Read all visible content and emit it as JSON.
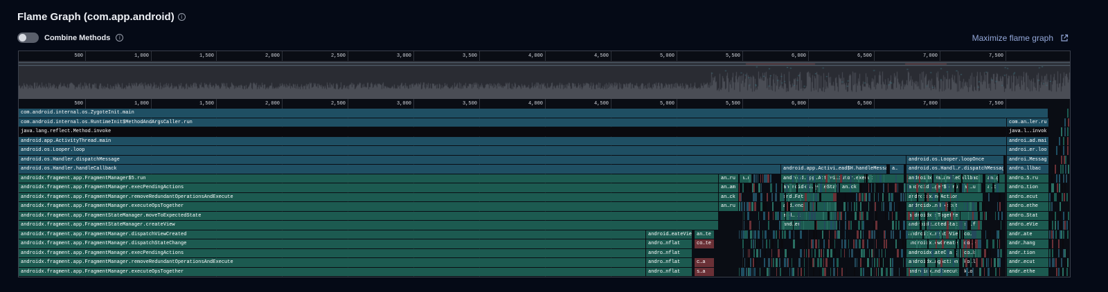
{
  "header": {
    "title": "Flame Graph (com.app.android)",
    "info_icon": "info-icon"
  },
  "controls": {
    "toggle_label": "Combine Methods",
    "toggle_on": false,
    "maximize_label": "Maximize flame graph",
    "maximize_icon": "external-link-icon"
  },
  "axis": {
    "ticks": [
      "500",
      "1,000",
      "1,500",
      "2,000",
      "2,500",
      "3,000",
      "3,500",
      "4,000",
      "4,500",
      "5,000",
      "5,500",
      "6,000",
      "6,500",
      "7,000",
      "7,500"
    ]
  },
  "colors": {
    "blue_frame": "#1f4f63",
    "teal_frame": "#1c5a50",
    "black_frame": "#0a0a0e",
    "red_frame": "#6a3036"
  },
  "stack_rows": [
    {
      "main": "com.android.internal.os.ZygoteInit.main",
      "color": "blue",
      "right": ""
    },
    {
      "main": "com.android.internal.os.RuntimeInit$MethodAndArgsCaller.run",
      "color": "blue",
      "right": "com.an…ler.ru"
    },
    {
      "main": "java.lang.reflect.Method.invoke",
      "color": "black",
      "right": "java.l….invok"
    },
    {
      "main": "android.app.ActivityThread.main",
      "color": "blue",
      "right": "androi…ad.mai"
    },
    {
      "main": "android.os.Looper.loop",
      "color": "blue",
      "right": "androi…er.loo"
    },
    {
      "main": "android.os.Handler.dispatchMessage",
      "color": "blue",
      "right": "androi…Messag"
    },
    {
      "main": "android.os.Handler.handleCallback",
      "color": "blue",
      "right": "andro…llbac"
    },
    {
      "main": "androidx.fragment.app.FragmentManager$5.run",
      "color": "teal",
      "right": "andro…5.ru"
    },
    {
      "main": "androidx.fragment.app.FragmentManager.execPendingActions",
      "color": "teal",
      "right": "andro…tion"
    },
    {
      "main": "androidx.fragment.app.FragmentManager.removeRedundantOperationsAndExecute",
      "color": "teal",
      "right": "andro…ecut"
    },
    {
      "main": "androidx.fragment.app.FragmentManager.executeOpsTogether",
      "color": "teal",
      "right": "andro…ethe"
    },
    {
      "main": "androidx.fragment.app.FragmentStateManager.moveToExpectedState",
      "color": "teal",
      "right": "andro…Stat"
    },
    {
      "main": "androidx.fragment.app.FragmentStateManager.createView",
      "color": "teal",
      "right": "andro…eVie"
    },
    {
      "main": "androidx.fragment.app.FragmentManager.dispatchViewCreated",
      "color": "teal",
      "right": "andr…ate"
    },
    {
      "main": "androidx.fragment.app.FragmentManager.dispatchStateChange",
      "color": "teal",
      "right": "andr…hang"
    },
    {
      "main": "androidx.fragment.app.FragmentManager.execPendingActions",
      "color": "teal",
      "right": "andr…tion"
    },
    {
      "main": "androidx.fragment.app.FragmentManager.removeRedundantOperationsAndExecute",
      "color": "teal",
      "right": "andr…ecut"
    },
    {
      "main": "androidx.fragment.app.FragmentManager.executeOpsTogether",
      "color": "teal",
      "right": "andr…ethe"
    }
  ],
  "sub_frames": [
    {
      "row": 5,
      "label": "android.os.Looper.loopOnce",
      "color": "blue"
    },
    {
      "row": 6,
      "label": "android.app.Activi…ead$H.handleMessag",
      "color": "blue"
    },
    {
      "row": 6,
      "label": "a…",
      "color": "blue"
    },
    {
      "row": 6,
      "label": "android.os.Handl…r.dispatchMessag",
      "color": "blue"
    },
    {
      "row": 7,
      "label": "an…ru",
      "color": "teal"
    },
    {
      "row": 7,
      "label": "a…u",
      "color": "teal"
    },
    {
      "row": 7,
      "label": "android.app.Activi…cutor.execut",
      "color": "teal"
    },
    {
      "row": 7,
      "label": "androidx.Ha…andleCallbac",
      "color": "teal"
    },
    {
      "row": 7,
      "label": "an…g",
      "color": "teal"
    },
    {
      "row": 8,
      "label": "an…am",
      "color": "teal"
    },
    {
      "row": 8,
      "label": "androidx.a…ycleStat",
      "color": "teal"
    },
    {
      "row": 8,
      "label": "an…ck",
      "color": "teal"
    },
    {
      "row": 8,
      "label": "androidx…ger$5.ru",
      "color": "teal"
    },
    {
      "row": 8,
      "label": "an…u",
      "color": "teal"
    },
    {
      "row": 8,
      "label": "a…t",
      "color": "teal"
    },
    {
      "row": 9,
      "label": "an…ck",
      "color": "teal"
    },
    {
      "row": 9,
      "label": "and…Fat",
      "color": "teal"
    },
    {
      "row": 9,
      "label": "androidx…ngAction",
      "color": "teal"
    },
    {
      "row": 10,
      "label": "an…ru",
      "color": "teal"
    },
    {
      "row": 10,
      "label": "and…enc",
      "color": "teal"
    },
    {
      "row": 10,
      "label": "androidx…ndExecut",
      "color": "teal"
    },
    {
      "row": 11,
      "label": "and…it",
      "color": "teal"
    },
    {
      "row": 11,
      "label": "androidx…sTogethe",
      "color": "teal"
    },
    {
      "row": 12,
      "label": "and…er",
      "color": "teal"
    },
    {
      "row": 12,
      "label": "androidx…ctedStat",
      "color": "teal"
    },
    {
      "row": 12,
      "label": "an…f",
      "color": "teal"
    },
    {
      "row": 13,
      "label": "android…eateVie",
      "color": "teal"
    },
    {
      "row": 13,
      "label": "an…te",
      "color": "teal"
    },
    {
      "row": 13,
      "label": "androidx…reateVie",
      "color": "teal"
    },
    {
      "row": 13,
      "label": "co…$",
      "color": "teal"
    },
    {
      "row": 14,
      "label": "andro…nflat",
      "color": "teal"
    },
    {
      "row": 14,
      "label": "co…te",
      "color": "red"
    },
    {
      "row": 14,
      "label": "androidx…ewCreate",
      "color": "teal"
    },
    {
      "row": 14,
      "label": "co…e",
      "color": "red"
    },
    {
      "row": 15,
      "label": "andro…nflat",
      "color": "teal"
    },
    {
      "row": 15,
      "label": "androidx…ateChang",
      "color": "teal"
    },
    {
      "row": 15,
      "label": "co…k",
      "color": "teal"
    },
    {
      "row": 16,
      "label": "andro…nflat",
      "color": "teal"
    },
    {
      "row": 16,
      "label": "c…a",
      "color": "red"
    },
    {
      "row": 16,
      "label": "androidx…ngAction",
      "color": "teal"
    },
    {
      "row": 16,
      "label": "ko…l",
      "color": "dark"
    },
    {
      "row": 17,
      "label": "andro…nflat",
      "color": "teal"
    },
    {
      "row": 17,
      "label": "s…a",
      "color": "red"
    },
    {
      "row": 17,
      "label": "androidx…ndExecut",
      "color": "teal"
    },
    {
      "row": 17,
      "label": "k…o",
      "color": "dark"
    }
  ]
}
